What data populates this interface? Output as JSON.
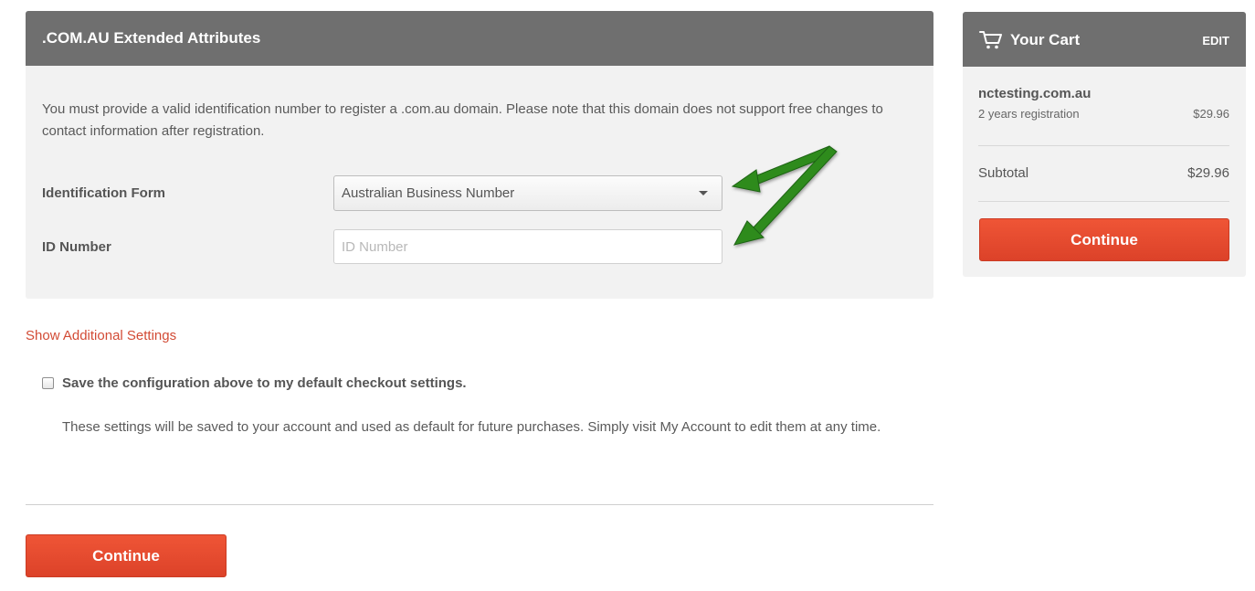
{
  "extended_attributes": {
    "title": ".COM.AU Extended Attributes",
    "description": "You must provide a valid identification number to register a .com.au domain. Please note that this domain does not support free changes to contact information after registration.",
    "identification_form": {
      "label": "Identification Form",
      "selected": "Australian Business Number"
    },
    "id_number": {
      "label": "ID Number",
      "value": "",
      "placeholder": "ID Number"
    }
  },
  "show_additional_settings": "Show Additional Settings",
  "save_config": {
    "checked": false,
    "label": "Save the configuration above to my default checkout settings.",
    "help": "These settings will be saved to your account and used as default for future purchases. Simply visit My Account to edit them at any time."
  },
  "continue_label": "Continue",
  "cart": {
    "icon": "cart-icon",
    "title": "Your Cart",
    "edit_label": "EDIT",
    "item": {
      "domain": "nctesting.com.au",
      "term": "2 years registration",
      "price": "$29.96"
    },
    "subtotal_label": "Subtotal",
    "subtotal_value": "$29.96",
    "continue_label": "Continue"
  },
  "colors": {
    "header_bg": "#6f6f6f",
    "panel_bg": "#f2f2f2",
    "accent_red": "#e54b2f",
    "link_red": "#d24b35",
    "arrow_green": "#2e8b1e"
  }
}
